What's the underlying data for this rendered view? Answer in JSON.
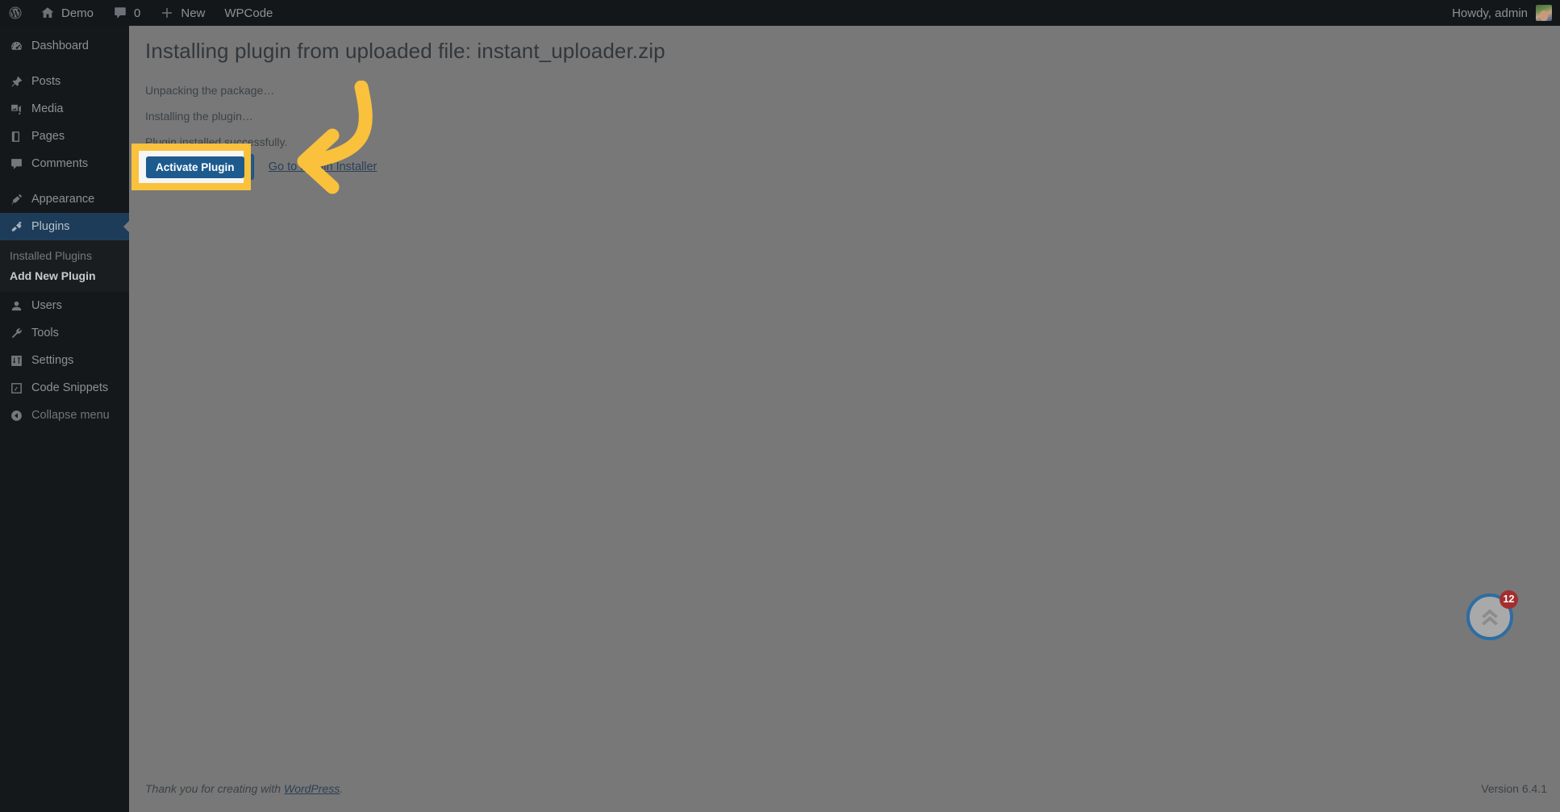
{
  "adminbar": {
    "logo_icon": "wordpress-logo-icon",
    "items": [
      {
        "icon": "home-icon",
        "label": "Demo"
      },
      {
        "icon": "comment-icon",
        "label": "0"
      },
      {
        "icon": "plus-icon",
        "label": "New"
      },
      {
        "icon": "",
        "label": "WPCode"
      }
    ],
    "greeting": "Howdy, admin",
    "avatar_name": "user-avatar"
  },
  "sidebar": {
    "items": [
      {
        "label": "Dashboard",
        "icon": "dashboard-icon",
        "active": false
      },
      {
        "label": "Posts",
        "icon": "pin-icon",
        "active": false
      },
      {
        "label": "Media",
        "icon": "media-icon",
        "active": false
      },
      {
        "label": "Pages",
        "icon": "page-icon",
        "active": false
      },
      {
        "label": "Comments",
        "icon": "comment-icon",
        "active": false
      },
      {
        "label": "Appearance",
        "icon": "brush-icon",
        "active": false
      },
      {
        "label": "Plugins",
        "icon": "plug-icon",
        "active": true
      },
      {
        "label": "Users",
        "icon": "user-icon",
        "active": false
      },
      {
        "label": "Tools",
        "icon": "wrench-icon",
        "active": false
      },
      {
        "label": "Settings",
        "icon": "sliders-icon",
        "active": false
      },
      {
        "label": "Code Snippets",
        "icon": "code-icon",
        "active": false
      },
      {
        "label": "Collapse menu",
        "icon": "collapse-icon",
        "active": false
      }
    ],
    "submenu": [
      {
        "label": "Installed Plugins",
        "current": false
      },
      {
        "label": "Add New Plugin",
        "current": true
      }
    ]
  },
  "main": {
    "title": "Installing plugin from uploaded file: instant_uploader.zip",
    "status_lines": [
      "Unpacking the package…",
      "Installing the plugin…",
      "Plugin installed successfully."
    ],
    "activate_label": "Activate Plugin",
    "goto_link_label": "Go to Plugin Installer"
  },
  "footer": {
    "thanks_prefix": "Thank you for creating with ",
    "thanks_link": "WordPress",
    "thanks_suffix": ".",
    "version": "Version 6.4.1"
  },
  "floating_badge": {
    "count": "12",
    "icon": "double-chevron-up-icon"
  },
  "annotation": {
    "highlight_label": "Activate Plugin",
    "arrow_name": "pointer-arrow",
    "highlight_color": "#fac13c",
    "arrow_color": "#fac13c"
  },
  "colors": {
    "admin_blue": "#1d5b8f",
    "sidebar_bg": "#15181b",
    "active_item_bg": "#1d3c5a",
    "page_bg": "#787878",
    "accent_yellow": "#fac13c"
  }
}
